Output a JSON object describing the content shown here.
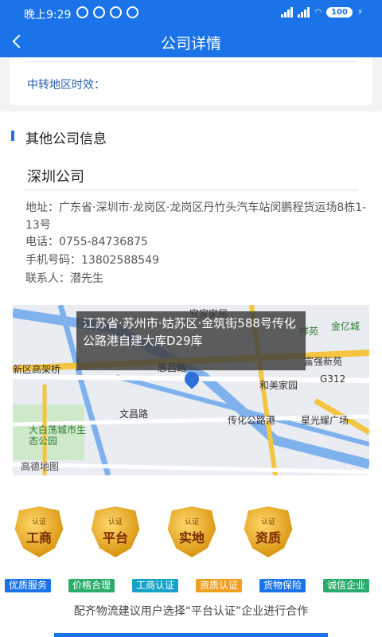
{
  "status_bar": {
    "time": "晚上9:29",
    "battery": "100",
    "icons": [
      "sync-off-icon",
      "alarm-icon",
      "circle-icon",
      "circle-icon",
      "signal-icon",
      "signal-icon",
      "wifi-icon",
      "charging-icon"
    ]
  },
  "header": {
    "title": "公司详情",
    "back_icon": "chevron-left-icon"
  },
  "transit": {
    "label": "中转地区时效："
  },
  "other_info": {
    "title": "其他公司信息",
    "company_name": "深圳公司",
    "address_label": "地址：",
    "address": "广东省·深圳市·龙岗区·龙岗区丹竹头汽车站闵鹏程货运场8栋1-13号",
    "phone_label": "电话：",
    "phone": "0755-84736875",
    "mobile_label": "手机号码：",
    "mobile": "13802588549",
    "contact_label": "联系人：",
    "contact": "潜先生"
  },
  "map": {
    "popup": "江苏省·苏州市·姑苏区·金筑街588号传化公路港自建大库D29库",
    "labels": [
      "宜家家居",
      "金亿城",
      "祥苑",
      "惠昌路",
      "富强新苑",
      "新区高架桥",
      "和美家园",
      "G312",
      "文昌路",
      "传化公路港",
      "星光耀广场",
      "大白荡城市生态公园",
      "高德地图"
    ]
  },
  "badges": [
    {
      "small": "认证",
      "big": "工商"
    },
    {
      "small": "认证",
      "big": "平台"
    },
    {
      "small": "认证",
      "big": "实地"
    },
    {
      "small": "认证",
      "big": "资质"
    }
  ],
  "tags": [
    {
      "label": "优质服务",
      "color": "#1a73e8"
    },
    {
      "label": "价格合理",
      "color": "#2bab6b"
    },
    {
      "label": "工商认证",
      "color": "#17a2c8"
    },
    {
      "label": "资质认证",
      "color": "#f0a020"
    },
    {
      "label": "货物保险",
      "color": "#1a73e8"
    },
    {
      "label": "诚信企业",
      "color": "#2bab6b"
    }
  ],
  "footer": {
    "text": "配齐物流建议用户选择“平台认证”企业进行合作"
  }
}
